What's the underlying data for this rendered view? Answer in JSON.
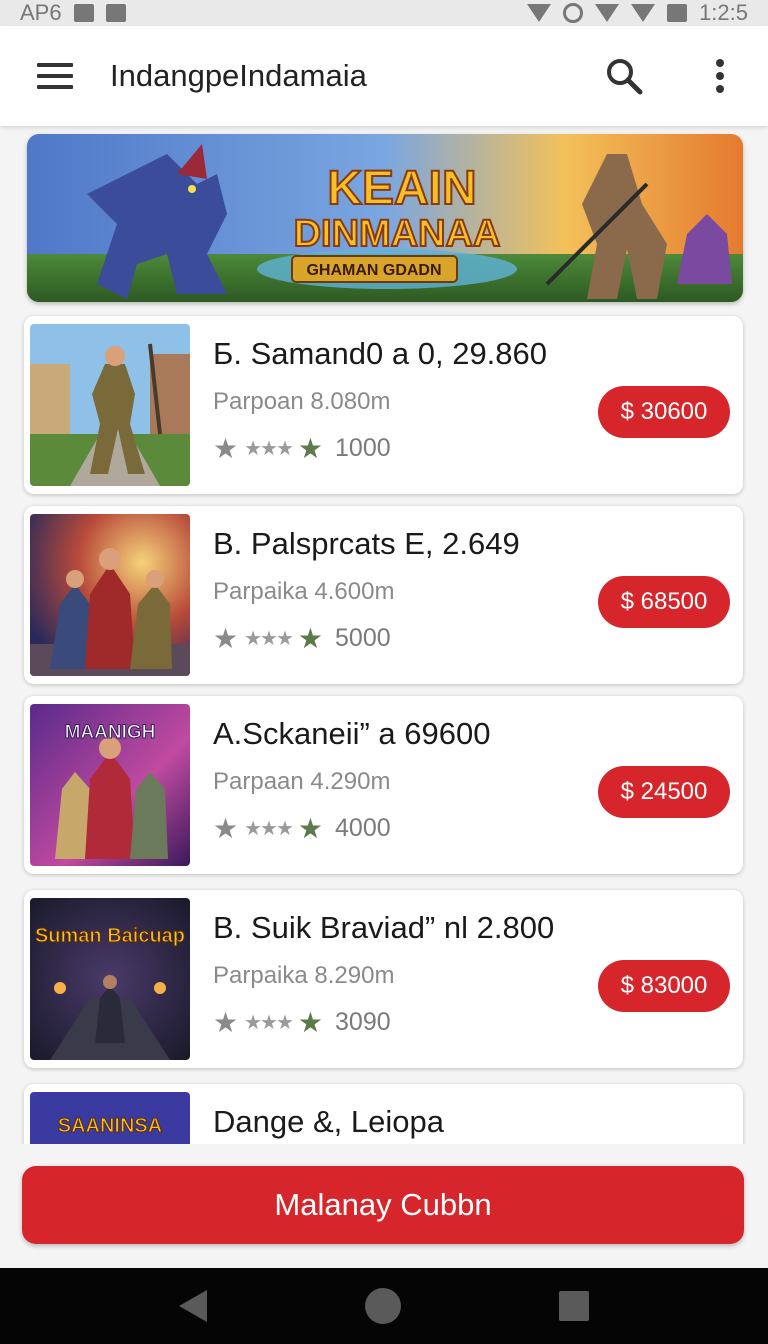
{
  "status_bar": {
    "left_text": "AP6",
    "time": "1:2:5"
  },
  "app_bar": {
    "title": "IndangpeIndamaia"
  },
  "banner": {
    "title_line1": "KEAIN",
    "title_line2": "DINMANAA",
    "subtitle": "GHAMAN GDADN"
  },
  "items": [
    {
      "title": "Б. Samand0 a 0, 29.860",
      "subtitle": "Parpoan 8.080m",
      "rating_count": "1000",
      "price": "$ 30600",
      "thumb_text": ""
    },
    {
      "title": "B. Palsprcats E, 2.649",
      "subtitle": "Parpaika 4.600m",
      "rating_count": "5000",
      "price": "$ 68500",
      "thumb_text": ""
    },
    {
      "title": "A.Sckaneii” a 69600",
      "subtitle": "Parpaan 4.290m",
      "rating_count": "4000",
      "price": "$ 24500",
      "thumb_text": "MAANIGH"
    },
    {
      "title": "B. Suik Braviad” nl 2.800",
      "subtitle": "Parpaika 8.290m",
      "rating_count": "3090",
      "price": "$ 83000",
      "thumb_text": "Suman Baicuap"
    },
    {
      "title": "Dange &, Leiopa",
      "subtitle": "",
      "rating_count": "",
      "price": "",
      "thumb_text": "SAANINSA"
    }
  ],
  "cta": {
    "label": "Malanay Cubbn"
  },
  "colors": {
    "accent": "#d7262b",
    "star_green": "#5c7a4a",
    "nav_bg": "#050505"
  },
  "icons": [
    "menu-icon",
    "search-icon",
    "more-vert-icon",
    "star-icon",
    "back-icon",
    "home-icon",
    "recents-icon"
  ]
}
